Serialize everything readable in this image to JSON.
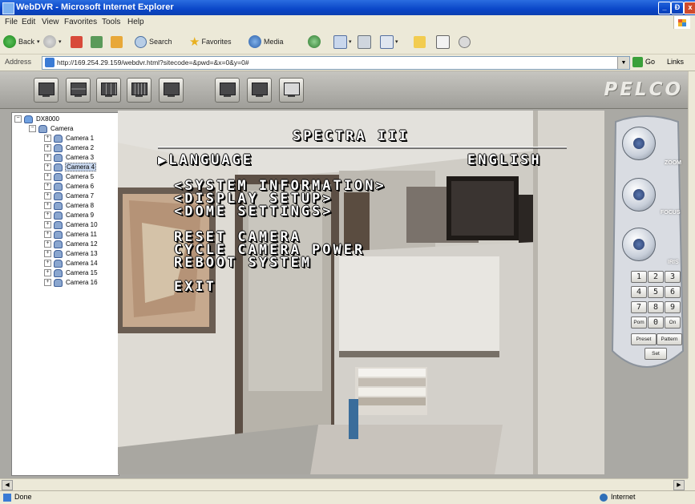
{
  "window": {
    "title": "WebDVR - Microsoft Internet Explorer",
    "controls": [
      "_",
      "Ɖ",
      "x"
    ]
  },
  "menu": [
    "File",
    "Edit",
    "View",
    "Favorites",
    "Tools",
    "Help"
  ],
  "toolbar": {
    "back": "Back",
    "search": "Search",
    "favorites": "Favorites",
    "media": "Media"
  },
  "address": {
    "label": "Address",
    "url": "http://169.254.29.159/webdvr.html?sitecode=&pwd=&x=0&y=0#",
    "go": "Go",
    "links": "Links"
  },
  "viewer": {
    "brand": "PELCO",
    "layout_buttons": [
      "single-view",
      "quad-view",
      "nine-view",
      "sixteen-view",
      "layout-1-plus-7",
      "layout-1-plus-5",
      "layout-2-plus-8",
      "full-screen"
    ]
  },
  "tree": {
    "root": "DX8000",
    "group": "Camera",
    "cameras": [
      "Camera 1",
      "Camera 2",
      "Camera 3",
      "Camera 4",
      "Camera 5",
      "Camera 6",
      "Camera 7",
      "Camera 8",
      "Camera 9",
      "Camera 10",
      "Camera 11",
      "Camera 12",
      "Camera 13",
      "Camera 14",
      "Camera 15",
      "Camera 16"
    ],
    "selected": "Camera 4"
  },
  "osd": {
    "title": "SPECTRA III",
    "language_label": "▶LANGUAGE",
    "language_value": "ENGLISH",
    "items": [
      "<SYSTEM INFORMATION>",
      "<DISPLAY SETUP>",
      "<DOME SETTINGS>",
      "RESET CAMERA",
      "CYCLE CAMERA POWER",
      "REBOOT SYSTEM",
      "EXIT"
    ]
  },
  "ptz": {
    "zoom": "ZOOM",
    "focus": "FOCUS",
    "iris": "IRIS",
    "keys": [
      "1",
      "2",
      "3",
      "4",
      "5",
      "6",
      "7",
      "8",
      "9"
    ],
    "bottom_keys": [
      "Pom",
      "0",
      "On"
    ],
    "preset": "Preset",
    "pattern": "Pattern",
    "set": "Set"
  },
  "status": {
    "left": "Done",
    "zone": "Internet"
  },
  "colors": {
    "titlebar": "#0a46c8",
    "viewer_bg": "#aaa9a4",
    "osd_text": "#ffffff"
  }
}
